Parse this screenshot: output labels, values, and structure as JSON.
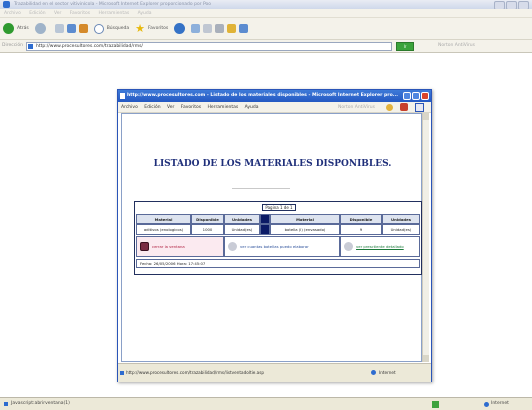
{
  "browser": {
    "window_title": "Trazabilidad en el sector vitivinícola - Microsoft Internet Explorer proporcionado por Poo",
    "menu": [
      "Archivo",
      "Edición",
      "Ver",
      "Favoritos",
      "Herramientas",
      "Ayuda"
    ],
    "toolbar": {
      "back": "Atrás",
      "search": "Búsqueda",
      "favorites": "Favoritos"
    },
    "address_label": "Dirección",
    "address": "http://www.procesultores.com/trazabilidad/rms/",
    "go_label": "Ir",
    "right_label": "Norton AntiVirus",
    "status_left": "Javascript:abrirventana(1)",
    "status_zone": "Internet"
  },
  "popup": {
    "title": "http://www.procesultores.com - Listado de los materiales disponibles - Microsoft Internet Explorer pro...",
    "menu": [
      "Archivo",
      "Edición",
      "Ver",
      "Favoritos",
      "Herramientas",
      "Ayuda"
    ],
    "menu_right": "Norton AntiVirus",
    "status_url": "http://www.procesultores.com/trazabilidad/rms/listventadoltie.asp",
    "status_zone": "Internet"
  },
  "page": {
    "heading": "LISTADO DE LOS MATERIALES DISPONIBLES.",
    "pagination": "Pagina 1 de 1",
    "columns": [
      "Material",
      "Disponible",
      "Unidades",
      "Material",
      "Disponible",
      "Unidades"
    ],
    "row": [
      "aditivos (enologicos)",
      "1000",
      "Unidad(es)",
      "botella (l) (envasado)",
      "9",
      "Unidad(es)"
    ],
    "actions": {
      "close": "cerrar la ventana",
      "howmany": "ver cuantas botellas puedo elaborar",
      "detail": "ver presctiente detallado"
    },
    "date_line": "Fecha: 26/05/2006 Hora: 17:45:07"
  },
  "colors": {
    "heading": "#1f2f7a",
    "table_border": "#22305f",
    "titlebar": "#2458c2"
  }
}
